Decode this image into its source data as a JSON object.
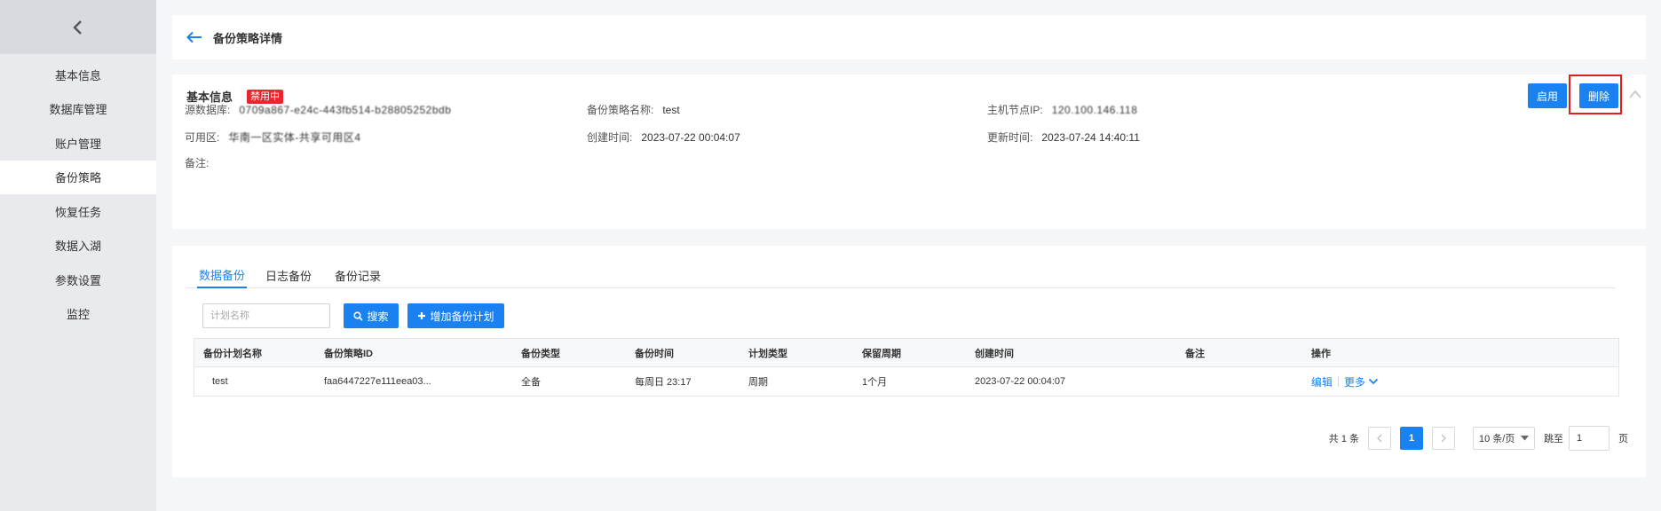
{
  "sidebar": {
    "items": [
      {
        "label": "基本信息"
      },
      {
        "label": "数据库管理"
      },
      {
        "label": "账户管理"
      },
      {
        "label": "备份策略"
      },
      {
        "label": "恢复任务"
      },
      {
        "label": "数据入湖"
      },
      {
        "label": "参数设置"
      },
      {
        "label": "监控"
      }
    ],
    "active_index": 3
  },
  "header": {
    "title": "备份策略详情"
  },
  "info": {
    "title": "基本信息",
    "status_badge": "禁用中",
    "enable_label": "启用",
    "delete_label": "删除",
    "fields": {
      "source_db_label": "源数据库:",
      "source_db_value": "0709a867-e24c-443fb514-b28805252bdb",
      "policy_name_label": "备份策略名称:",
      "policy_name_value": "test",
      "host_ip_label": "主机节点IP:",
      "host_ip_value": "120.100.146.118",
      "zone_label": "可用区:",
      "zone_value": "华南一区实体-共享可用区4",
      "created_label": "创建时间:",
      "created_value": "2023-07-22 00:04:07",
      "updated_label": "更新时间:",
      "updated_value": "2023-07-24 14:40:11",
      "remark_label": "备注:"
    }
  },
  "tabs": [
    {
      "label": "数据备份"
    },
    {
      "label": "日志备份"
    },
    {
      "label": "备份记录"
    }
  ],
  "toolbar": {
    "search_placeholder": "计划名称",
    "search_label": "搜索",
    "add_label": "增加备份计划"
  },
  "table": {
    "headers": [
      "备份计划名称",
      "备份策略ID",
      "备份类型",
      "备份时间",
      "计划类型",
      "保留周期",
      "创建时间",
      "备注",
      "操作"
    ],
    "rows": [
      {
        "name": "test",
        "policy_id": "faa6447227e111eea03...",
        "type": "全备",
        "time": "每周日 23:17",
        "plan_type": "周期",
        "retention": "1个月",
        "created": "2023-07-22 00:04:07",
        "remark": "",
        "edit": "编辑",
        "more": "更多"
      }
    ]
  },
  "pager": {
    "total": "共 1 条",
    "current": "1",
    "page_size": "10 条/页",
    "goto_label": "跳至",
    "goto_value": "1",
    "unit": "页"
  },
  "colors": {
    "primary": "#1a82f0",
    "danger": "#e8262e"
  }
}
